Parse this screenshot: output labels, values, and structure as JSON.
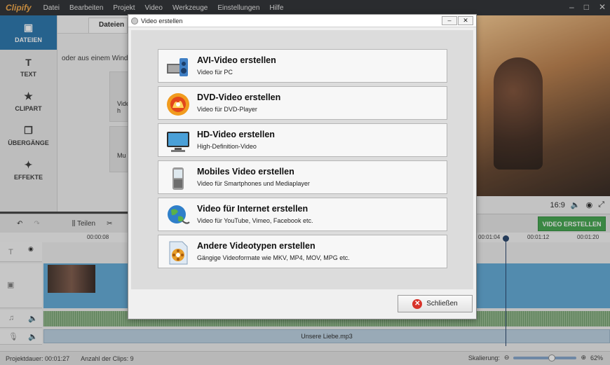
{
  "app": {
    "logo": "Clipify"
  },
  "menu": [
    "Datei",
    "Bearbeiten",
    "Projekt",
    "Video",
    "Werkzeuge",
    "Einstellungen",
    "Hilfe"
  ],
  "sidebar": {
    "items": [
      {
        "label": "DATEIEN",
        "icon": "film-icon"
      },
      {
        "label": "TEXT",
        "icon": "text-icon"
      },
      {
        "label": "CLIPART",
        "icon": "star-icon"
      },
      {
        "label": "ÜBERGÄNGE",
        "icon": "transition-icon"
      },
      {
        "label": "EFFEKTE",
        "icon": "wand-icon"
      }
    ]
  },
  "filepanel": {
    "tab": "Dateien",
    "hint": "oder aus einem Windows",
    "drop1": "Video",
    "drop1b": "h",
    "drop2": "Mu"
  },
  "preview": {
    "aspect": "16:9"
  },
  "toolbar": {
    "split": "Teilen",
    "export": "VIDEO ERSTELLEN"
  },
  "ruler": [
    "00:00:08",
    "00:01:04",
    "00:01:12",
    "00:01:20"
  ],
  "timeline": {
    "audio_file": "Unsere Liebe.mp3"
  },
  "status": {
    "duration_label": "Projektdauer:",
    "duration": "00:01:27",
    "clips_label": "Anzahl der Clips:",
    "clips": "9",
    "scale_label": "Skalierung:",
    "zoom": "62%"
  },
  "dialog": {
    "title": "Video erstellen",
    "options": [
      {
        "title": "AVI-Video erstellen",
        "sub": "Video für PC",
        "icon": "speaker-icon"
      },
      {
        "title": "DVD-Video erstellen",
        "sub": "Video für DVD-Player",
        "icon": "dvd-icon"
      },
      {
        "title": "HD-Video erstellen",
        "sub": "High-Definition-Video",
        "icon": "monitor-icon"
      },
      {
        "title": "Mobiles Video erstellen",
        "sub": "Video für Smartphones und Mediaplayer",
        "icon": "phone-icon"
      },
      {
        "title": "Video für Internet erstellen",
        "sub": "Video für YouTube, Vimeo, Facebook etc.",
        "icon": "globe-icon"
      },
      {
        "title": "Andere Videotypen erstellen",
        "sub": "Gängige Videoformate wie MKV, MP4, MOV, MPG etc.",
        "icon": "film-file-icon"
      }
    ],
    "close": "Schließen"
  }
}
